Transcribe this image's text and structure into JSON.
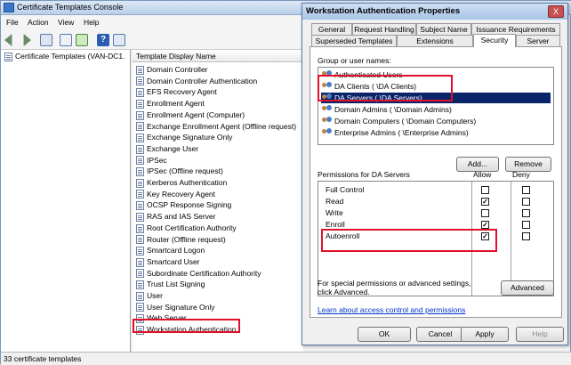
{
  "console": {
    "title": "Certificate Templates Console",
    "menu": [
      "File",
      "Action",
      "View",
      "Help"
    ],
    "tree_root": "Certificate Templates (VAN-DC1.",
    "column_header": "Template Display Name",
    "templates": [
      "Domain Controller",
      "Domain Controller Authentication",
      "EFS Recovery Agent",
      "Enrollment Agent",
      "Enrollment Agent (Computer)",
      "Exchange Enrollment Agent (Offline request)",
      "Exchange Signature Only",
      "Exchange User",
      "IPSec",
      "IPSec (Offline request)",
      "Kerberos Authentication",
      "Key Recovery Agent",
      "OCSP Response Signing",
      "RAS and IAS Server",
      "Root Certification Authority",
      "Router (Offline request)",
      "Smartcard Logon",
      "Smartcard User",
      "Subordinate Certification Authority",
      "Trust List Signing",
      "User",
      "User Signature Only",
      "Web Server",
      "Workstation Authentication"
    ],
    "status": "33 certificate templates"
  },
  "dialog": {
    "title": "Workstation Authentication Properties",
    "close_label": "X",
    "tabs_row1": [
      "General",
      "Request Handling",
      "Subject Name",
      "Issuance Requirements"
    ],
    "tabs_row2": [
      "Superseded Templates",
      "Extensions",
      "Security",
      "Server"
    ],
    "group_label": "Group or user names:",
    "users": [
      {
        "label": "Authenticated Users",
        "selected": false
      },
      {
        "label": "DA Clients (              \\DA Clients)",
        "selected": false
      },
      {
        "label": "DA Servers (              \\DA Servers)",
        "selected": true
      },
      {
        "label": "Domain Admins (              \\Domain Admins)",
        "selected": false
      },
      {
        "label": "Domain Computers (              \\Domain Computers)",
        "selected": false
      },
      {
        "label": "Enterprise Admins (              \\Enterprise Admins)",
        "selected": false
      }
    ],
    "add_button": "Add...",
    "remove_button": "Remove",
    "permissions_label": "Permissions for DA Servers",
    "allow_header": "Allow",
    "deny_header": "Deny",
    "permissions": [
      {
        "name": "Full Control",
        "allow": false,
        "deny": false
      },
      {
        "name": "Read",
        "allow": true,
        "deny": false
      },
      {
        "name": "Write",
        "allow": false,
        "deny": false
      },
      {
        "name": "Enroll",
        "allow": true,
        "deny": false
      },
      {
        "name": "Autoenroll",
        "allow": true,
        "deny": false
      }
    ],
    "special_text": "For special permissions or advanced settings, click Advanced.",
    "advanced_button": "Advanced",
    "learn_link": "Learn about access control and permissions",
    "ok_button": "OK",
    "cancel_button": "Cancel",
    "apply_button": "Apply",
    "help_button": "Help"
  },
  "colors": {
    "highlight": "#e0102a",
    "selection": "#0a246a",
    "link": "#0033cc"
  }
}
